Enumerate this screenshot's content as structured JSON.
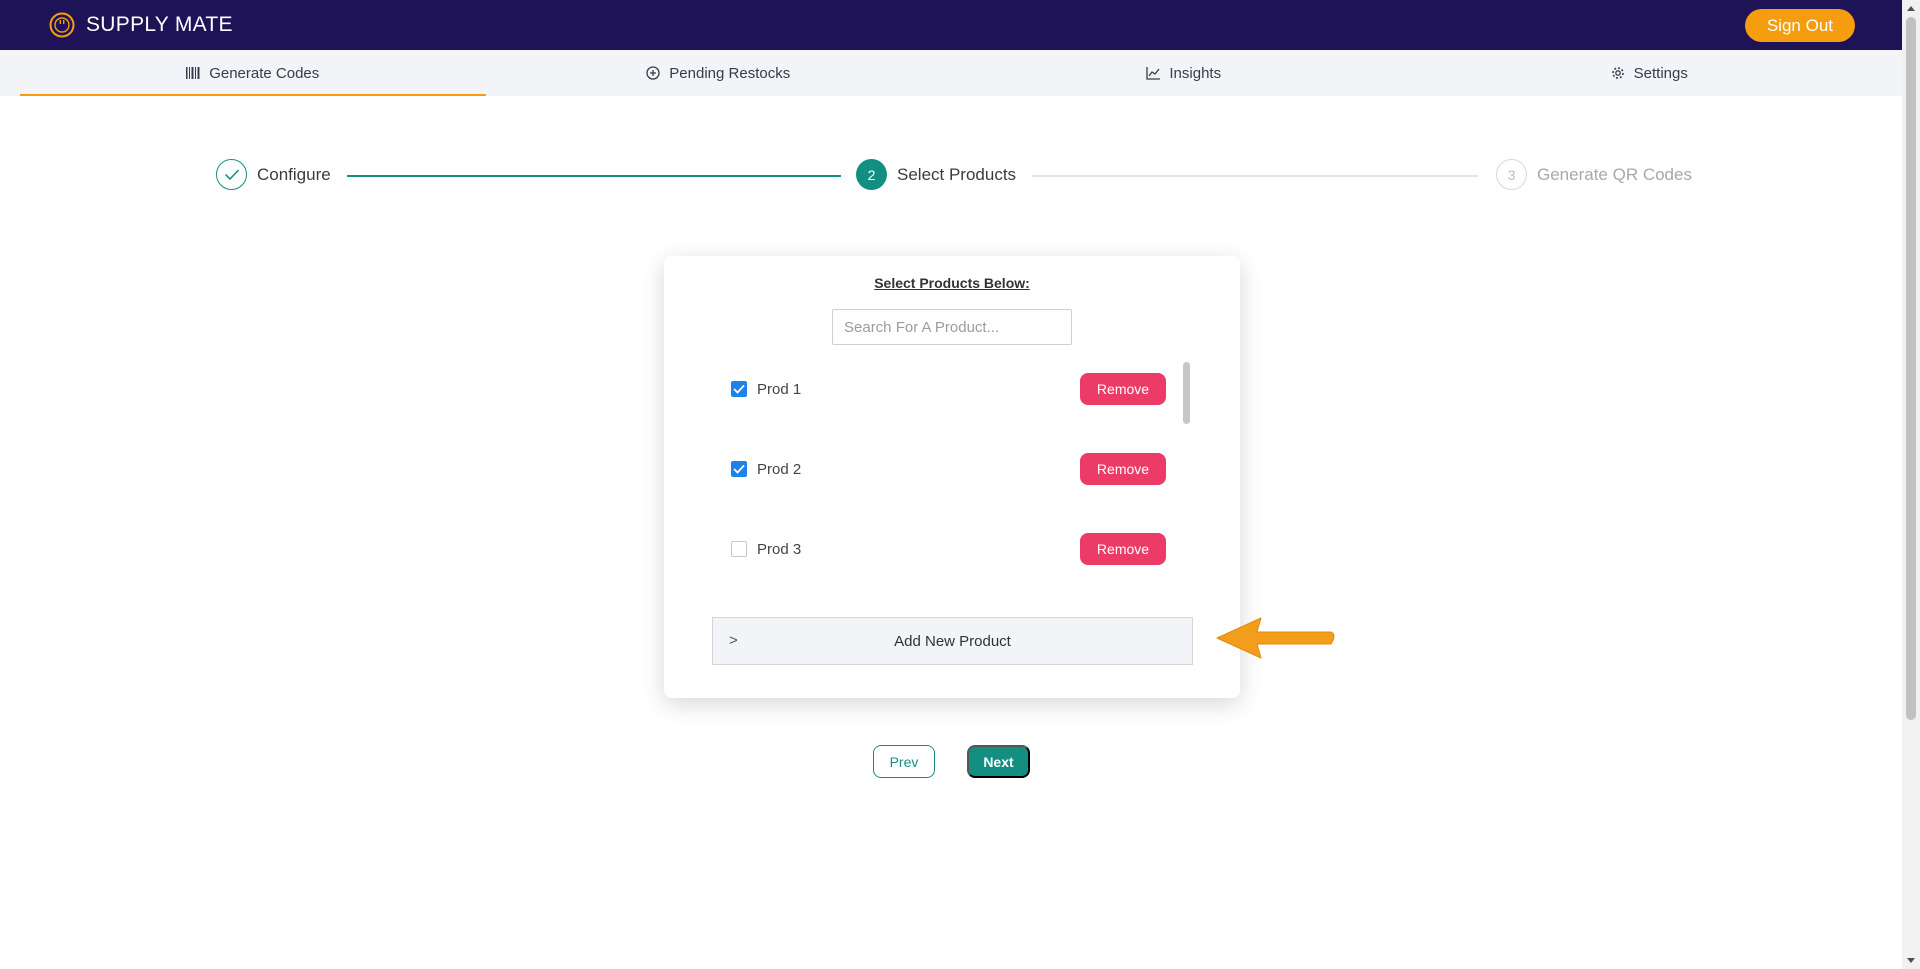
{
  "app": {
    "brand": "SUPPLY MATE",
    "sign_out_label": "Sign Out"
  },
  "colors": {
    "header_bg": "#1e1356",
    "accent": "#f59d0e",
    "primary": "#138f82",
    "danger": "#ec3b66",
    "checkbox": "#1e83e8"
  },
  "tabs": [
    {
      "label": "Generate Codes",
      "icon": "barcode-icon",
      "active": true
    },
    {
      "label": "Pending Restocks",
      "icon": "plus-circle-icon",
      "active": false
    },
    {
      "label": "Insights",
      "icon": "line-chart-icon",
      "active": false
    },
    {
      "label": "Settings",
      "icon": "gear-icon",
      "active": false
    }
  ],
  "stepper": {
    "steps": [
      {
        "number": "1",
        "label": "Configure",
        "state": "done"
      },
      {
        "number": "2",
        "label": "Select Products",
        "state": "current"
      },
      {
        "number": "3",
        "label": "Generate QR Codes",
        "state": "todo"
      }
    ]
  },
  "card": {
    "title": "Select Products Below:",
    "search_placeholder": "Search For A Product...",
    "products": [
      {
        "label": "Prod 1",
        "checked": true,
        "remove_label": "Remove"
      },
      {
        "label": "Prod 2",
        "checked": true,
        "remove_label": "Remove"
      },
      {
        "label": "Prod 3",
        "checked": false,
        "remove_label": "Remove"
      }
    ],
    "add_new_label": "Add New Product"
  },
  "nav": {
    "prev_label": "Prev",
    "next_label": "Next"
  }
}
